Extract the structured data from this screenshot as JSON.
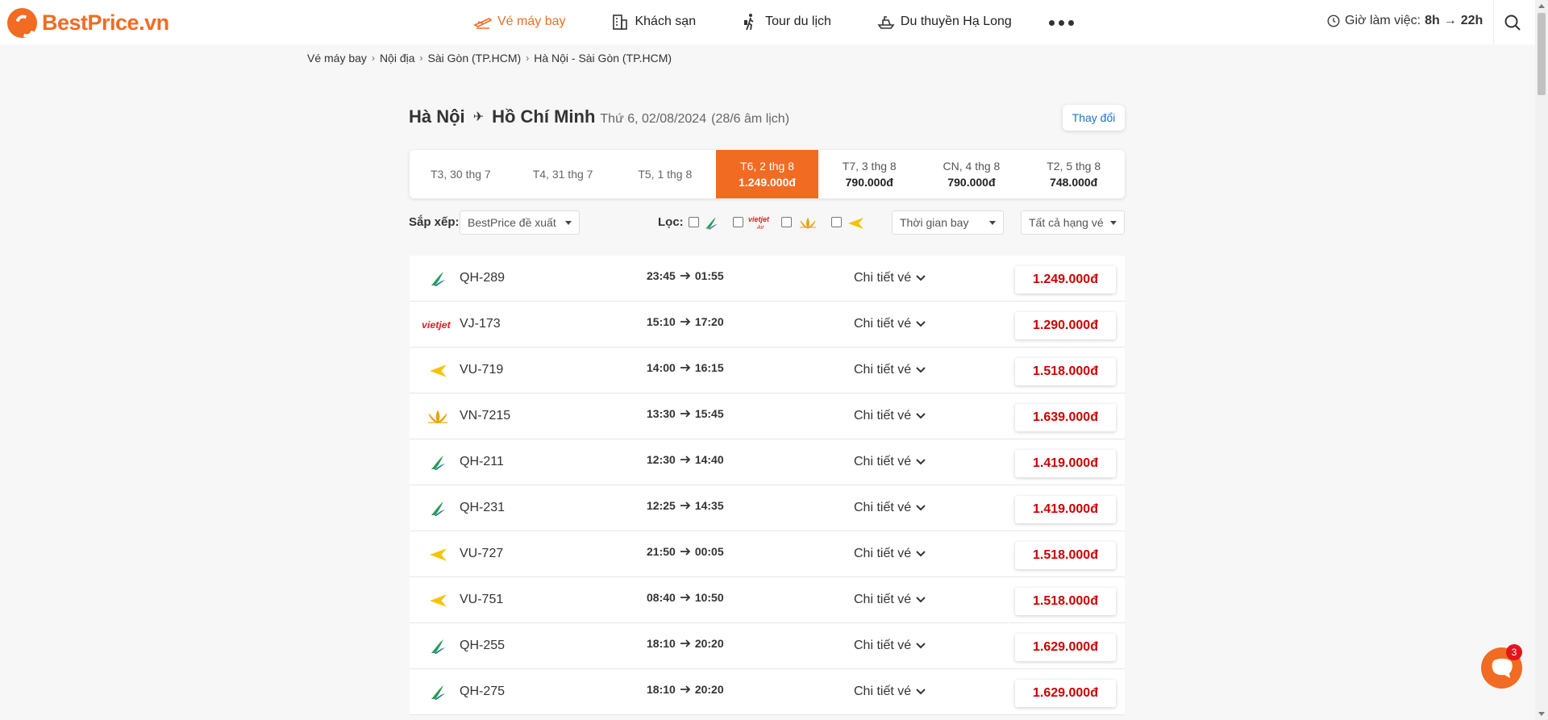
{
  "header": {
    "brand": "BestPrice.vn",
    "nav": [
      {
        "label": "Vé máy bay",
        "icon": "plane-icon",
        "active": true
      },
      {
        "label": "Khách sạn",
        "icon": "hotel-icon",
        "active": false
      },
      {
        "label": "Tour du lịch",
        "icon": "traveler-icon",
        "active": false
      },
      {
        "label": "Du thuyền Hạ Long",
        "icon": "cruise-icon",
        "active": false
      }
    ],
    "work_hours_label": "Giờ làm việc:",
    "work_hours_from": "8h",
    "work_hours_arrow": "→",
    "work_hours_to": "22h"
  },
  "breadcrumb": [
    "Vé máy bay",
    "Nội địa",
    "Sài Gòn (TP.HCM)",
    "Hà Nội - Sài Gòn (TP.HCM)"
  ],
  "route": {
    "from": "Hà Nội",
    "to": "Hồ Chí Minh",
    "date": "Thứ 6, 02/08/2024",
    "lunar": "(28/6 âm lịch)",
    "change_label": "Thay đổi"
  },
  "dates": [
    {
      "day": "T3, 30 thg 7",
      "price": ""
    },
    {
      "day": "T4, 31 thg 7",
      "price": ""
    },
    {
      "day": "T5, 1 thg 8",
      "price": ""
    },
    {
      "day": "T6, 2 thg 8",
      "price": "1.249.000đ",
      "active": true
    },
    {
      "day": "T7, 3 thg 8",
      "price": "790.000đ"
    },
    {
      "day": "CN, 4 thg 8",
      "price": "790.000đ"
    },
    {
      "day": "T2, 5 thg 8",
      "price": "748.000đ"
    }
  ],
  "filters": {
    "sort_label": "Sắp xếp:",
    "sort_value": "BestPrice đề xuất",
    "filter_label": "Lọc:",
    "time_value": "Thời gian bay",
    "class_value": "Tất cả hạng vé",
    "vietjet_logo_text": "vietjet Air"
  },
  "detail_label": "Chi tiết vé",
  "flights": [
    {
      "airline": "bamboo",
      "code": "QH-289",
      "dep": "23:45",
      "arr": "01:55",
      "price": "1.249.000đ"
    },
    {
      "airline": "vietjet",
      "code": "VJ-173",
      "dep": "15:10",
      "arr": "17:20",
      "price": "1.290.000đ"
    },
    {
      "airline": "vietravel",
      "code": "VU-719",
      "dep": "14:00",
      "arr": "16:15",
      "price": "1.518.000đ"
    },
    {
      "airline": "vietnam",
      "code": "VN-7215",
      "dep": "13:30",
      "arr": "15:45",
      "price": "1.639.000đ"
    },
    {
      "airline": "bamboo",
      "code": "QH-211",
      "dep": "12:30",
      "arr": "14:40",
      "price": "1.419.000đ"
    },
    {
      "airline": "bamboo",
      "code": "QH-231",
      "dep": "12:25",
      "arr": "14:35",
      "price": "1.419.000đ"
    },
    {
      "airline": "vietravel",
      "code": "VU-727",
      "dep": "21:50",
      "arr": "00:05",
      "price": "1.518.000đ"
    },
    {
      "airline": "vietravel",
      "code": "VU-751",
      "dep": "08:40",
      "arr": "10:50",
      "price": "1.518.000đ"
    },
    {
      "airline": "bamboo",
      "code": "QH-255",
      "dep": "18:10",
      "arr": "20:20",
      "price": "1.629.000đ"
    },
    {
      "airline": "bamboo",
      "code": "QH-275",
      "dep": "18:10",
      "arr": "20:20",
      "price": "1.629.000đ"
    }
  ],
  "chat": {
    "badge": "3"
  },
  "colors": {
    "brand": "#f26b22",
    "price": "#cc0000",
    "link": "#1a73c9"
  }
}
